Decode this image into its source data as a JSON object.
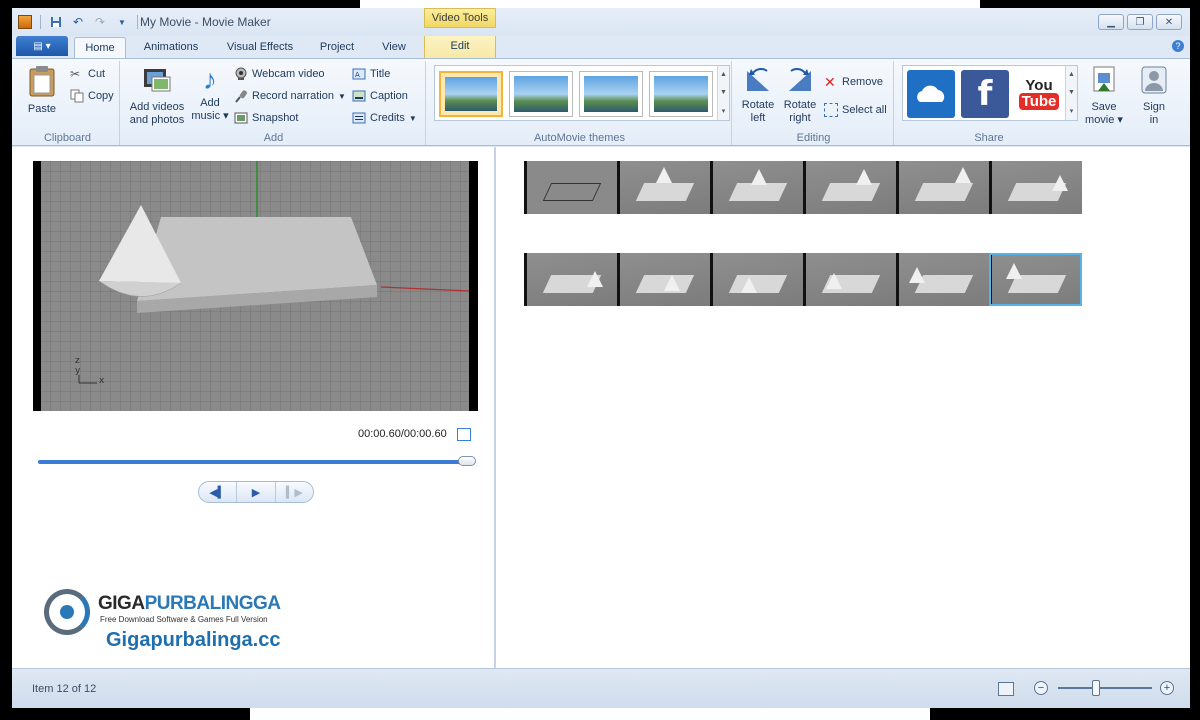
{
  "window": {
    "title": "My Movie - Movie Maker",
    "contextual_tab_group": "Video Tools"
  },
  "tabs": [
    {
      "label": "Home",
      "active": true
    },
    {
      "label": "Animations"
    },
    {
      "label": "Visual Effects"
    },
    {
      "label": "Project"
    },
    {
      "label": "View"
    },
    {
      "label": "Edit",
      "contextual": true
    }
  ],
  "ribbon": {
    "clipboard": {
      "label": "Clipboard",
      "paste": "Paste",
      "cut": "Cut",
      "copy": "Copy"
    },
    "add": {
      "label": "Add",
      "add_videos_line1": "Add videos",
      "add_videos_line2": "and photos",
      "add_music_line1": "Add",
      "add_music_line2": "music",
      "webcam_video": "Webcam video",
      "record_narration": "Record narration",
      "snapshot": "Snapshot",
      "title": "Title",
      "caption": "Caption",
      "credits": "Credits"
    },
    "automovie": {
      "label": "AutoMovie themes",
      "selected_index": 0
    },
    "editing": {
      "label": "Editing",
      "rotate_left_line1": "Rotate",
      "rotate_left_line2": "left",
      "rotate_right_line1": "Rotate",
      "rotate_right_line2": "right",
      "remove": "Remove",
      "select_all": "Select all"
    },
    "share": {
      "label": "Share",
      "youtube_line1": "You",
      "youtube_line2": "Tube",
      "facebook": "f",
      "save_movie_line1": "Save",
      "save_movie_line2": "movie",
      "sign_in_line1": "Sign",
      "sign_in_line2": "in"
    }
  },
  "player": {
    "time_readout": "00:00.60/00:00.60",
    "progress": 1.0
  },
  "watermark": {
    "brand_part1": "GIGA",
    "brand_part2": "PURBALINGGA",
    "tagline": "Free Download Software & Games Full Version",
    "url": "Gigapurbalinga.cc"
  },
  "storyboard": {
    "rows": [
      {
        "clips": 6
      },
      {
        "clips": 6,
        "selected_clip": 5
      }
    ]
  },
  "statusbar": {
    "item_text": "Item 12 of 12",
    "zoom_level": 0.45
  },
  "colors": {
    "accent": "#3b7bd4",
    "contextual_tab": "#f1d765",
    "selection": "#56b4e9"
  }
}
